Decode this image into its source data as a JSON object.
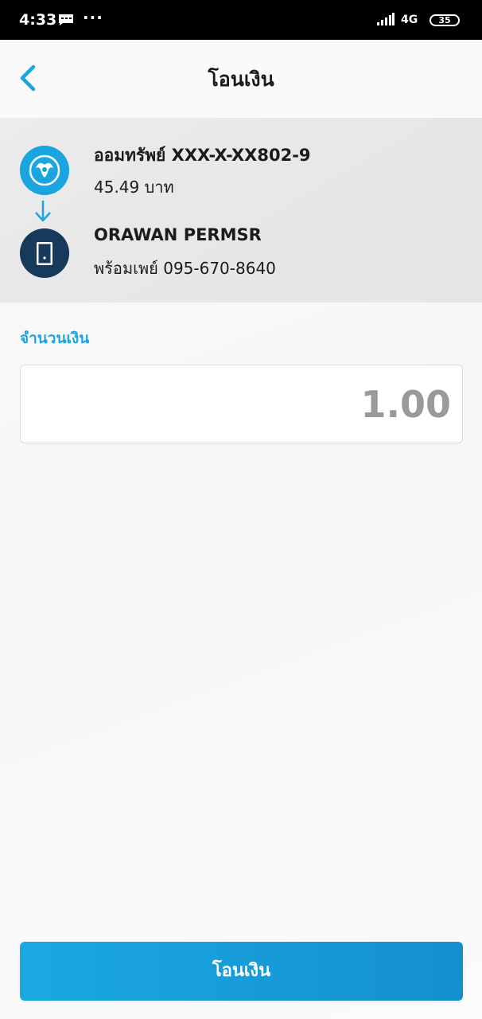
{
  "status_bar": {
    "time": "4:33",
    "dots": "···",
    "network": "4G",
    "battery": "35"
  },
  "header": {
    "title": "โอนเงิน"
  },
  "transfer": {
    "from": {
      "account": "ออมทรัพย์ XXX-X-XX802-9",
      "balance": "45.49 บาท"
    },
    "to": {
      "name": "ORAWAN PERMSR",
      "detail": "พร้อมเพย์ 095-670-8640"
    }
  },
  "amount": {
    "label": "จำนวนเงิน",
    "value": "1.00"
  },
  "submit": {
    "label": "โอนเงิน"
  },
  "colors": {
    "accent": "#1ba5e0",
    "dark_navy": "#163a5c"
  }
}
